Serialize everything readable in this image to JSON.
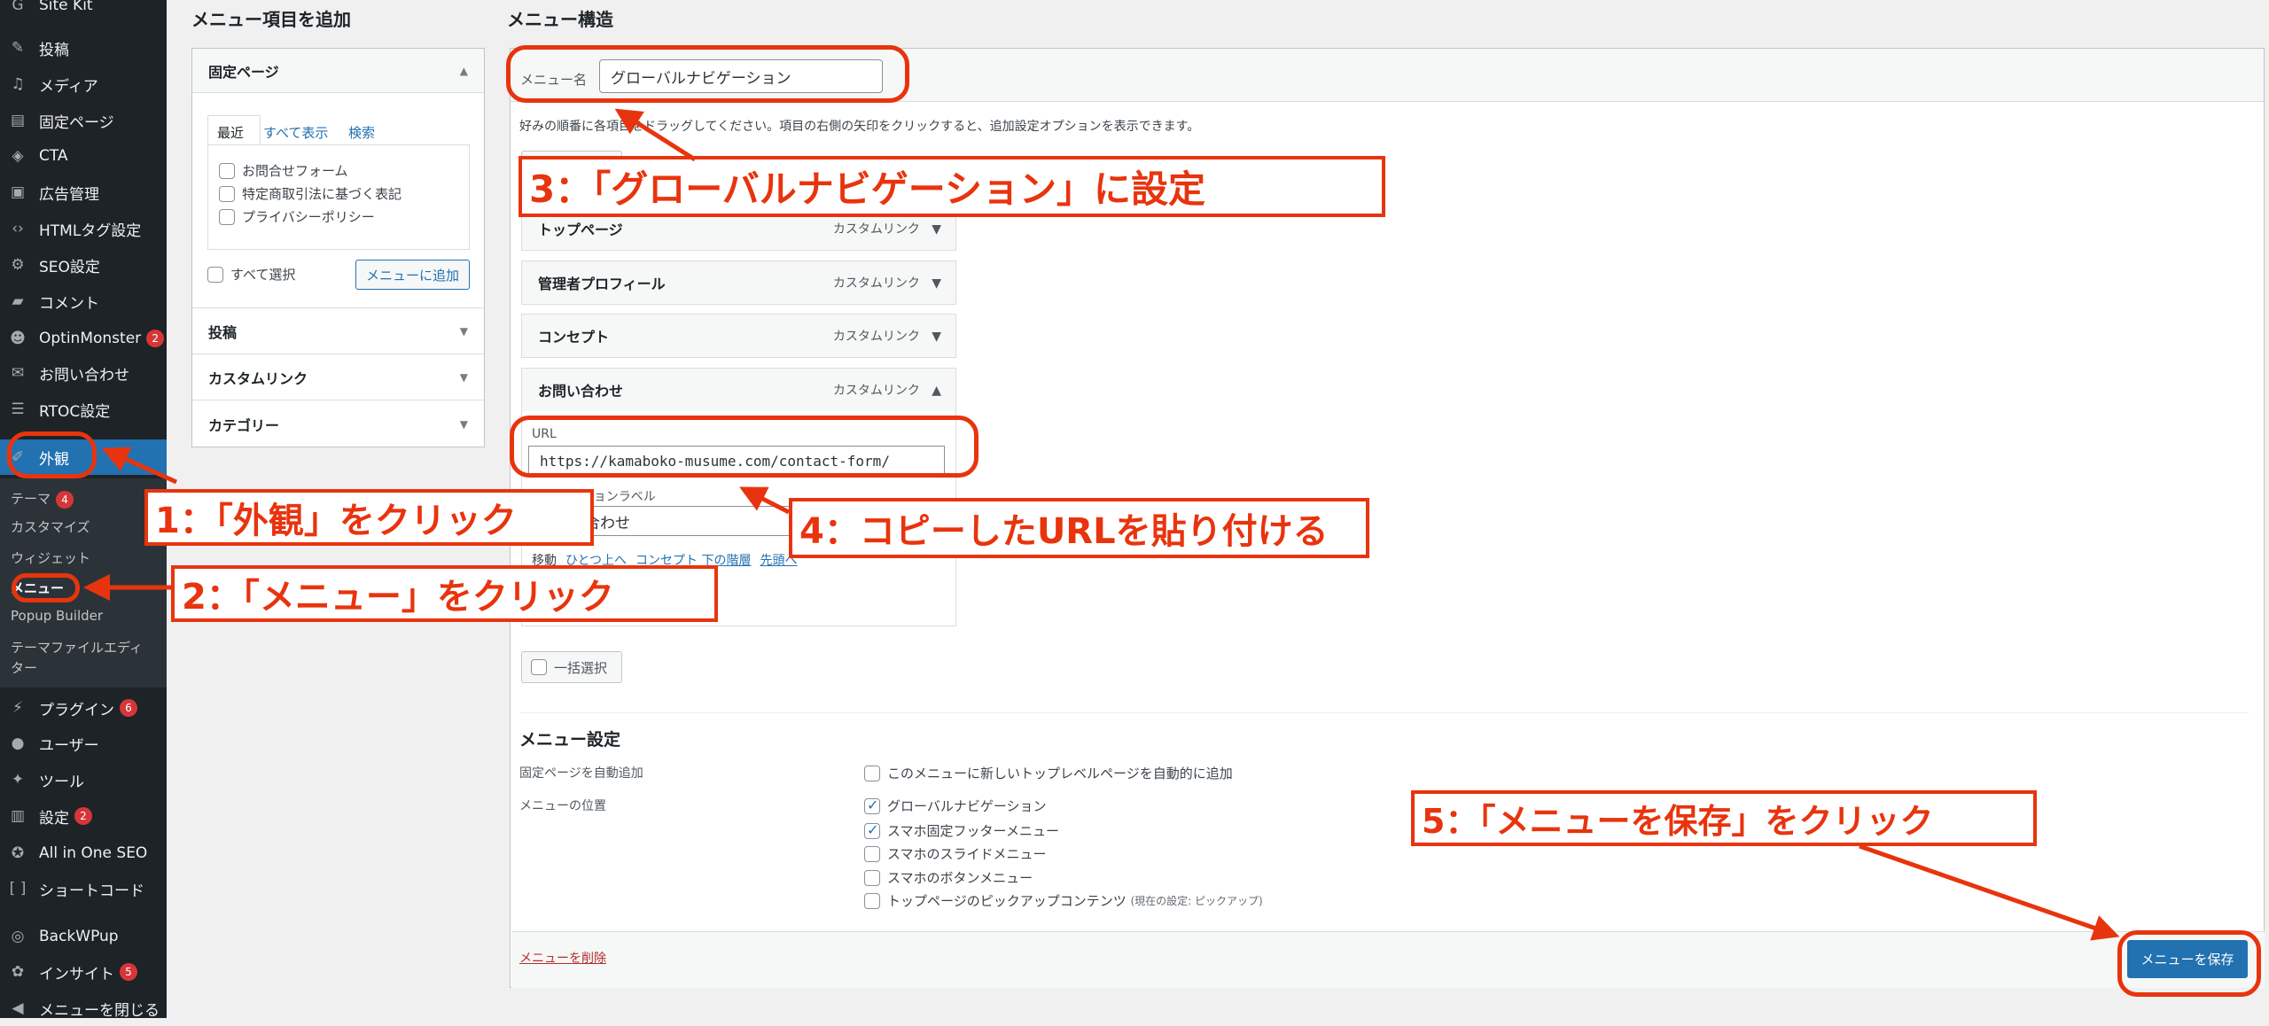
{
  "sidebar": {
    "items": [
      {
        "label": "Site Kit",
        "icon": "google-icon"
      },
      {
        "label": "投稿",
        "icon": "pin-icon"
      },
      {
        "label": "メディア",
        "icon": "media-icon"
      },
      {
        "label": "固定ページ",
        "icon": "page-icon"
      },
      {
        "label": "CTA",
        "icon": "tag-icon"
      },
      {
        "label": "広告管理",
        "icon": "ad-icon"
      },
      {
        "label": "HTMLタグ設定",
        "icon": "code-icon"
      },
      {
        "label": "SEO設定",
        "icon": "gear-icon"
      },
      {
        "label": "コメント",
        "icon": "comment-icon"
      },
      {
        "label": "OptinMonster",
        "icon": "monster-icon",
        "badge": "2"
      },
      {
        "label": "お問い合わせ",
        "icon": "mail-icon"
      },
      {
        "label": "RTOC設定",
        "icon": "list-icon"
      },
      {
        "label": "外観",
        "icon": "brush-icon"
      }
    ],
    "submenu": [
      "テーマ",
      "カスタマイズ",
      "ウィジェット",
      "メニュー",
      "Popup Builder",
      "テーマファイルエディ",
      "ター"
    ],
    "theme_badge": "4",
    "items_after": [
      {
        "label": "プラグイン",
        "icon": "plugin-icon",
        "badge": "6"
      },
      {
        "label": "ユーザー",
        "icon": "user-icon"
      },
      {
        "label": "ツール",
        "icon": "wrench-icon"
      },
      {
        "label": "設定",
        "icon": "settings-icon",
        "badge": "2"
      },
      {
        "label": "All in One SEO",
        "icon": "aioseo-icon"
      },
      {
        "label": "ショートコード",
        "icon": "brackets-icon"
      },
      {
        "label": "BackWPup",
        "icon": "backup-icon"
      },
      {
        "label": "インサイト",
        "icon": "insight-icon",
        "badge": "5"
      },
      {
        "label": "メニューを閉じる",
        "icon": "collapse-icon"
      }
    ]
  },
  "add_items": {
    "title": "メニュー項目を追加",
    "pages_section": "固定ページ",
    "tabs": [
      "最近",
      "すべて表示",
      "検索"
    ],
    "pages": [
      "お問合せフォーム",
      "特定商取引法に基づく表記",
      "プライバシーポリシー"
    ],
    "select_all": "すべて選択",
    "add_button": "メニューに追加",
    "sections": [
      "投稿",
      "カスタムリンク",
      "カテゴリー"
    ]
  },
  "structure": {
    "title": "メニュー構造",
    "menu_name_label": "メニュー名",
    "menu_name_value": "グローバルナビゲーション",
    "instructions": "好みの順番に各項目をドラッグしてください。項目の右側の矢印をクリックすると、追加設定オプションを表示できます。",
    "bulk_select": "一括選択",
    "items": [
      {
        "title": "トップページ",
        "type": "カスタムリンク"
      },
      {
        "title": "管理者プロフィール",
        "type": "カスタムリンク"
      },
      {
        "title": "コンセプト",
        "type": "カスタムリンク"
      },
      {
        "title": "お問い合わせ",
        "type": "カスタムリンク"
      }
    ],
    "url_label": "URL",
    "url_value": "https://kamaboko-musume.com/contact-form/",
    "nav_label": "ナビゲーションラベル",
    "nav_value": "お問い合わせ",
    "move_label": "移動",
    "move_links": [
      "ひとつ上へ",
      "コンセプト 下の階層",
      "先頭へ"
    ]
  },
  "settings": {
    "title": "メニュー設定",
    "auto_add_label": "固定ページを自動追加",
    "auto_add_option": "このメニューに新しいトップレベルページを自動的に追加",
    "location_label": "メニューの位置",
    "locations": [
      {
        "label": "グローバルナビゲーション",
        "checked": true
      },
      {
        "label": "スマホ固定フッターメニュー",
        "checked": true
      },
      {
        "label": "スマホのスライドメニュー",
        "checked": false
      },
      {
        "label": "スマホのボタンメニュー",
        "checked": false
      },
      {
        "label": "トップページのピックアップコンテンツ",
        "checked": false,
        "note": "(現在の設定: ピックアップ)"
      }
    ],
    "delete_link": "メニューを削除",
    "save_button": "メニューを保存"
  },
  "annotations": [
    "1：「外観」をクリック",
    "2：「メニュー」をクリック",
    "3：「グローバルナビゲーション」に設定",
    "4：コピーしたURLを貼り付ける",
    "5：「メニューを保存」をクリック"
  ],
  "colors": {
    "accent": "#2271b1",
    "annotation": "#e8340e",
    "sidebar": "#1d2327",
    "badge": "#d63638"
  }
}
